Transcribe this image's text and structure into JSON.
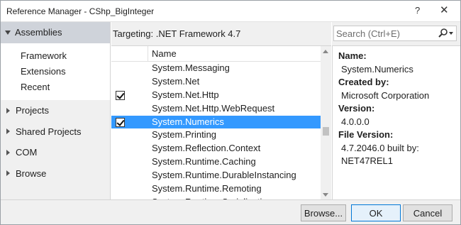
{
  "window": {
    "title": "Reference Manager - CShp_BigInteger",
    "help_glyph": "?",
    "close_glyph": "✕"
  },
  "sidebar": {
    "header": "Assemblies",
    "subitems": [
      "Framework",
      "Extensions",
      "Recent"
    ],
    "items": [
      "Projects",
      "Shared Projects",
      "COM",
      "Browse"
    ]
  },
  "main": {
    "targeting": "Targeting: .NET Framework 4.7",
    "column_header": "Name",
    "rows": [
      {
        "name": "System.Messaging",
        "checked": false,
        "selected": false
      },
      {
        "name": "System.Net",
        "checked": false,
        "selected": false
      },
      {
        "name": "System.Net.Http",
        "checked": true,
        "selected": false
      },
      {
        "name": "System.Net.Http.WebRequest",
        "checked": false,
        "selected": false
      },
      {
        "name": "System.Numerics",
        "checked": true,
        "selected": true
      },
      {
        "name": "System.Printing",
        "checked": false,
        "selected": false
      },
      {
        "name": "System.Reflection.Context",
        "checked": false,
        "selected": false
      },
      {
        "name": "System.Runtime.Caching",
        "checked": false,
        "selected": false
      },
      {
        "name": "System.Runtime.DurableInstancing",
        "checked": false,
        "selected": false
      },
      {
        "name": "System.Runtime.Remoting",
        "checked": false,
        "selected": false
      },
      {
        "name": "System.Runtime.Serialization",
        "checked": false,
        "selected": false
      }
    ]
  },
  "search": {
    "placeholder": "Search (Ctrl+E)",
    "icon": "search-icon"
  },
  "details": {
    "name_label": "Name:",
    "name_value": "System.Numerics",
    "created_label": "Created by:",
    "created_value": "Microsoft Corporation",
    "version_label": "Version:",
    "version_value": "4.0.0.0",
    "file_version_label": "File Version:",
    "file_version_line1": "4.7.2046.0 built by:",
    "file_version_line2": "NET47REL1"
  },
  "buttons": {
    "browse": "Browse...",
    "ok": "OK",
    "cancel": "Cancel"
  },
  "colors": {
    "selection": "#3399ff",
    "nav_selected": "#cfd3da",
    "ok_border": "#0078d7"
  }
}
